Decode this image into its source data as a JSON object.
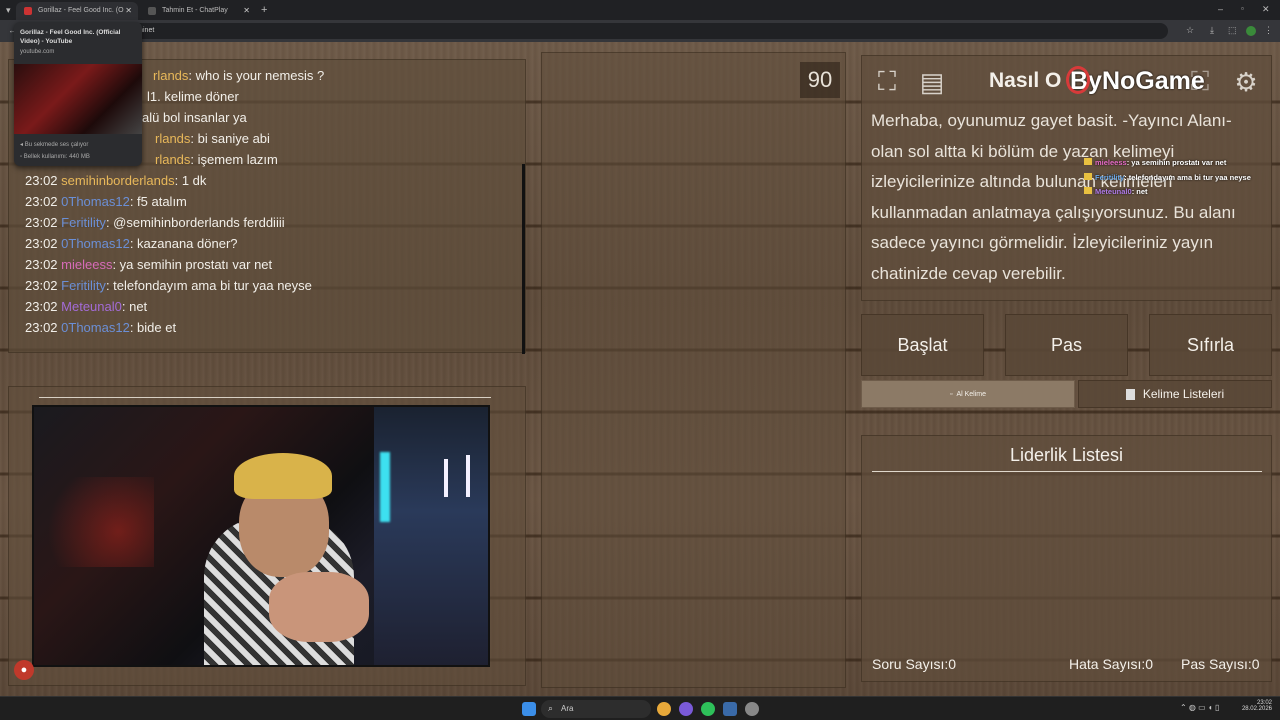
{
  "browser": {
    "tabs": [
      {
        "title": "Gorillaz - Feel Good Inc. (O"
      },
      {
        "title": "Tahmin Et - ChatPlay"
      }
    ],
    "url": "s/tahminet",
    "tooltip": {
      "title": "Gorillaz - Feel Good Inc. (Official Video) - YouTube",
      "site": "youtube.com",
      "audio_text": "Bu sekmede ses çalıyor",
      "memory_text": "Bellek kullanımı: 440 MB"
    }
  },
  "chat": {
    "messages": [
      {
        "time": "",
        "user": "rlands",
        "text": ": who is your nemesis ?",
        "color": "#e8b85a"
      },
      {
        "time": "",
        "user": "",
        "text": "l1. kelime döner",
        "color": "#f2efe9"
      },
      {
        "time": "",
        "user": "",
        "text": "alü bol insanlar ya",
        "color": "#f2efe9"
      },
      {
        "time": "",
        "user": "rlands",
        "text": ": bi saniye abi",
        "color": "#e8b85a"
      },
      {
        "time": "",
        "user": "rlands",
        "text": ": işemem lazım",
        "color": "#e8b85a"
      },
      {
        "time": "23:02",
        "user": "semihinborderlands",
        "text": ": 1 dk",
        "color": "#e8b85a"
      },
      {
        "time": "23:02",
        "user": "0Thomas12",
        "text": ": f5 atalım",
        "color": "#6b8fd6"
      },
      {
        "time": "23:02",
        "user": "Feritility",
        "text": ": @semihinborderlands ferddiiii",
        "color": "#6b8fd6"
      },
      {
        "time": "23:02",
        "user": "0Thomas12",
        "text": ": kazanana döner?",
        "color": "#6b8fd6"
      },
      {
        "time": "23:02",
        "user": "mieleess",
        "text": ": ya semihin prostatı var net",
        "color": "#d66bb8"
      },
      {
        "time": "23:02",
        "user": "Feritility",
        "text": ": telefondayım ama bi tur yaa neyse",
        "color": "#6b8fd6"
      },
      {
        "time": "23:02",
        "user": "Meteunal0",
        "text": ": net",
        "color": "#a36bd6"
      },
      {
        "time": "23:02",
        "user": "0Thomas12",
        "text": ": bide et",
        "color": "#6b8fd6"
      }
    ]
  },
  "game": {
    "timer": "90",
    "title_left": "Nasıl O",
    "brand": "ByNoGame",
    "description": "Merhaba, oyunumuz gayet basit. -Yayıncı Alanı- olan sol altta ki bölüm de yazan kelimeyi izleyicilerinize altında bulunan kelimeleri kullanmadan anlatmaya çalışıyorsunuz. Bu alanı sadece yayıncı görmelidir. İzleyicileriniz yayın chatinizde cevap verebilir.",
    "overlay_chat": [
      {
        "user": "mieleess",
        "text": ": ya semihin prostatı var net",
        "color": "#e86bc8"
      },
      {
        "user": "Feritility",
        "text": ": telefondayım ama bi tur yaa neyse",
        "color": "#6ba8e8"
      },
      {
        "user": "Meteunal0",
        "text": ": net",
        "color": "#b07be8"
      }
    ],
    "buttons": {
      "start": "Başlat",
      "pass": "Pas",
      "reset": "Sıfırla"
    },
    "get_word": "Al Kelime",
    "word_lists": "Kelime Listeleri",
    "leaderboard_title": "Liderlik Listesi",
    "stats": {
      "questions": "Soru Sayısı:0",
      "errors": "Hata Sayısı:0",
      "passes": "Pas Sayısı:0"
    }
  },
  "taskbar": {
    "search": "Ara",
    "time": "23:02",
    "date": "28.02.2026"
  }
}
